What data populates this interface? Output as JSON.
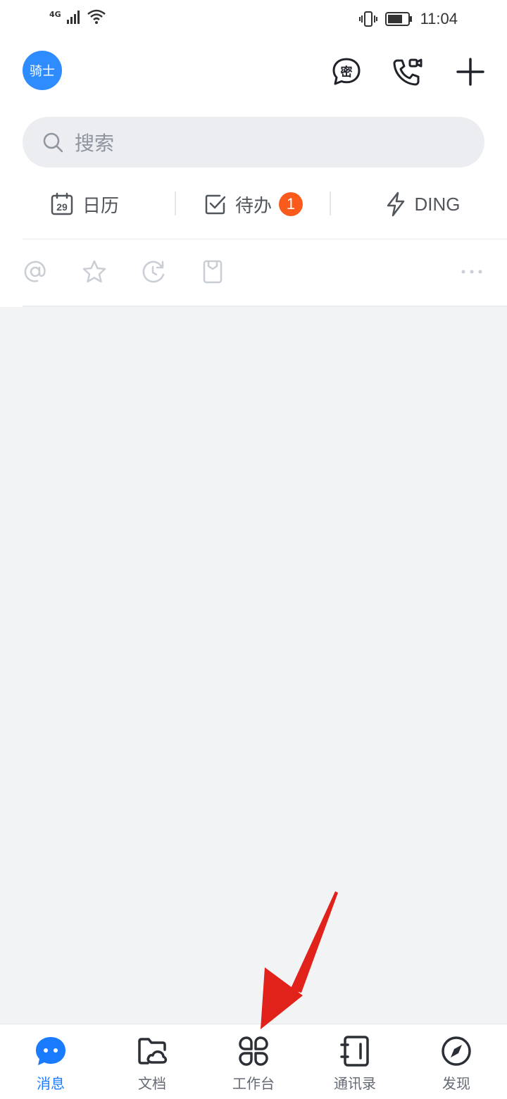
{
  "status_bar": {
    "network": "4G",
    "time": "11:04",
    "icons": [
      "signal-icon",
      "wifi-icon",
      "vibrate-icon",
      "battery-icon"
    ]
  },
  "header": {
    "avatar_text": "骑士",
    "actions": [
      "secret-chat-icon",
      "video-call-icon",
      "add-icon"
    ]
  },
  "search": {
    "placeholder": "搜索"
  },
  "quick_actions": [
    {
      "label": "日历",
      "icon": "calendar-icon",
      "calendar_day": "29"
    },
    {
      "label": "待办",
      "icon": "todo-icon",
      "badge": "1"
    },
    {
      "label": "DING",
      "icon": "lightning-icon"
    }
  ],
  "filters": [
    "mention-icon",
    "star-icon",
    "history-icon",
    "bookmark-icon",
    "more-icon"
  ],
  "tabbar": {
    "items": [
      {
        "label": "消息",
        "icon": "message-icon",
        "active": true
      },
      {
        "label": "文档",
        "icon": "docs-folder-icon",
        "active": false
      },
      {
        "label": "工作台",
        "icon": "workbench-icon",
        "active": false
      },
      {
        "label": "通讯录",
        "icon": "contacts-icon",
        "active": false
      },
      {
        "label": "发现",
        "icon": "compass-icon",
        "active": false
      }
    ]
  },
  "colors": {
    "accent": "#1a7bff",
    "badge": "#fa5a1c",
    "background": "#f2f3f5",
    "annotation_arrow": "#e0221b"
  }
}
